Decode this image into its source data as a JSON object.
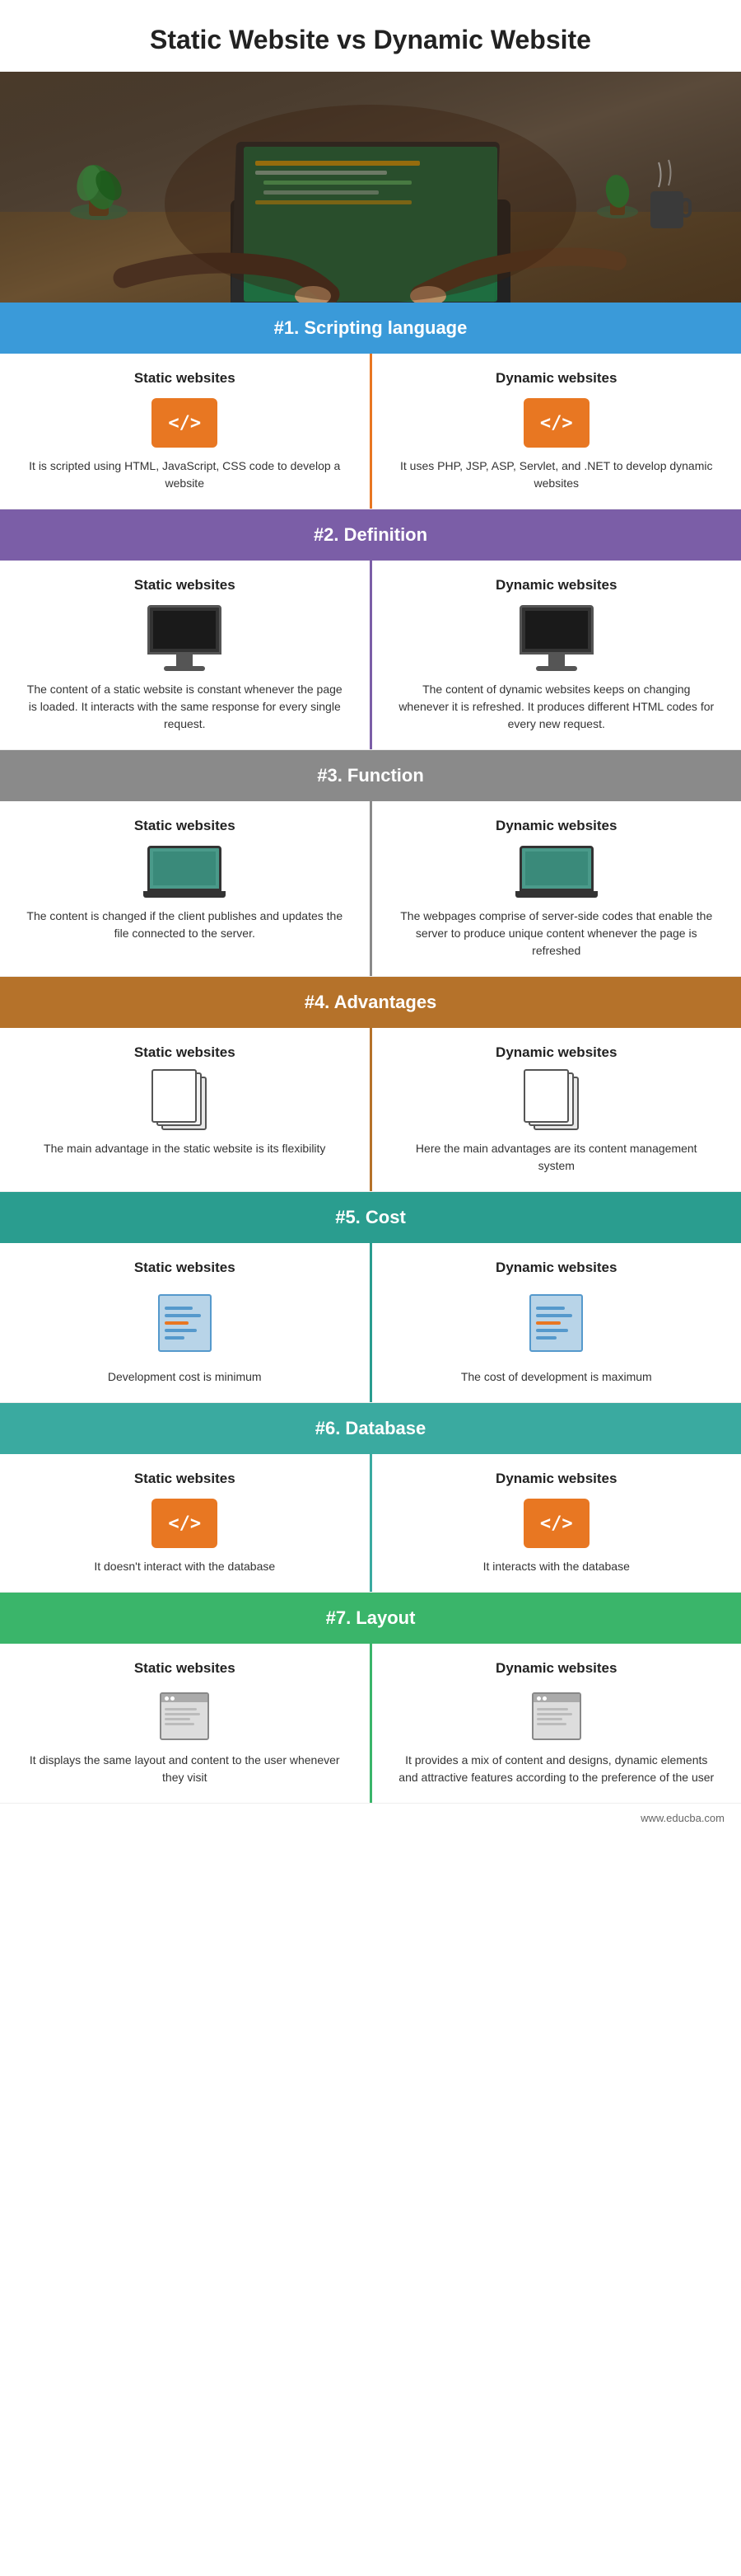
{
  "title": "Static Website vs Dynamic Website",
  "watermark": "www.educba.com",
  "sections": [
    {
      "id": "scripting",
      "number": "#1. Scripting language",
      "headerClass": "blue",
      "dividerColor": "#e87722",
      "left": {
        "title": "Static websites",
        "iconType": "code",
        "desc": "It is scripted using HTML, JavaScript, CSS code to develop a website"
      },
      "right": {
        "title": "Dynamic websites",
        "iconType": "code",
        "desc": "It uses PHP, JSP, ASP, Servlet, and .NET to develop dynamic websites"
      }
    },
    {
      "id": "definition",
      "number": "#2. Definition",
      "headerClass": "purple",
      "dividerColor": "#7b5ea7",
      "left": {
        "title": "Static websites",
        "iconType": "monitor",
        "desc": "The content of a static website is constant whenever the page is loaded. It interacts with the same response for every single request."
      },
      "right": {
        "title": "Dynamic websites",
        "iconType": "monitor",
        "desc": "The content of dynamic websites keeps on changing whenever it is refreshed. It produces different HTML codes for every new request."
      }
    },
    {
      "id": "function",
      "number": "#3. Function",
      "headerClass": "gray",
      "dividerColor": "#8a8a8a",
      "left": {
        "title": "Static websites",
        "iconType": "laptop",
        "desc": "The content is changed if the client publishes and updates the file connected to the server."
      },
      "right": {
        "title": "Dynamic websites",
        "iconType": "laptop",
        "desc": "The webpages comprise of server-side codes that enable the server to produce unique content whenever the page is refreshed"
      }
    },
    {
      "id": "advantages",
      "number": "#4. Advantages",
      "headerClass": "brown",
      "dividerColor": "#b5722a",
      "left": {
        "title": "Static websites",
        "iconType": "files",
        "desc": "The main advantage in the static website is its flexibility"
      },
      "right": {
        "title": "Dynamic websites",
        "iconType": "files",
        "desc": "Here the main advantages are its content management system"
      }
    },
    {
      "id": "cost",
      "number": "#5. Cost",
      "headerClass": "teal",
      "dividerColor": "#2a9d8f",
      "left": {
        "title": "Static websites",
        "iconType": "cost",
        "desc": "Development cost is minimum"
      },
      "right": {
        "title": "Dynamic websites",
        "iconType": "cost",
        "desc": "The cost of development is maximum"
      }
    },
    {
      "id": "database",
      "number": "#6. Database",
      "headerClass": "teal2",
      "dividerColor": "#3aaaa0",
      "left": {
        "title": "Static websites",
        "iconType": "code",
        "desc": "It doesn't interact with the database"
      },
      "right": {
        "title": "Dynamic websites",
        "iconType": "code",
        "desc": "It interacts with the database"
      }
    },
    {
      "id": "layout",
      "number": "#7. Layout",
      "headerClass": "green",
      "dividerColor": "#3ab56a",
      "left": {
        "title": "Static websites",
        "iconType": "layout",
        "desc": "It displays the same layout and content to the user whenever they visit"
      },
      "right": {
        "title": "Dynamic websites",
        "iconType": "layout",
        "desc": "It provides a mix of content and designs, dynamic elements and attractive features according to the preference of the user"
      }
    }
  ]
}
